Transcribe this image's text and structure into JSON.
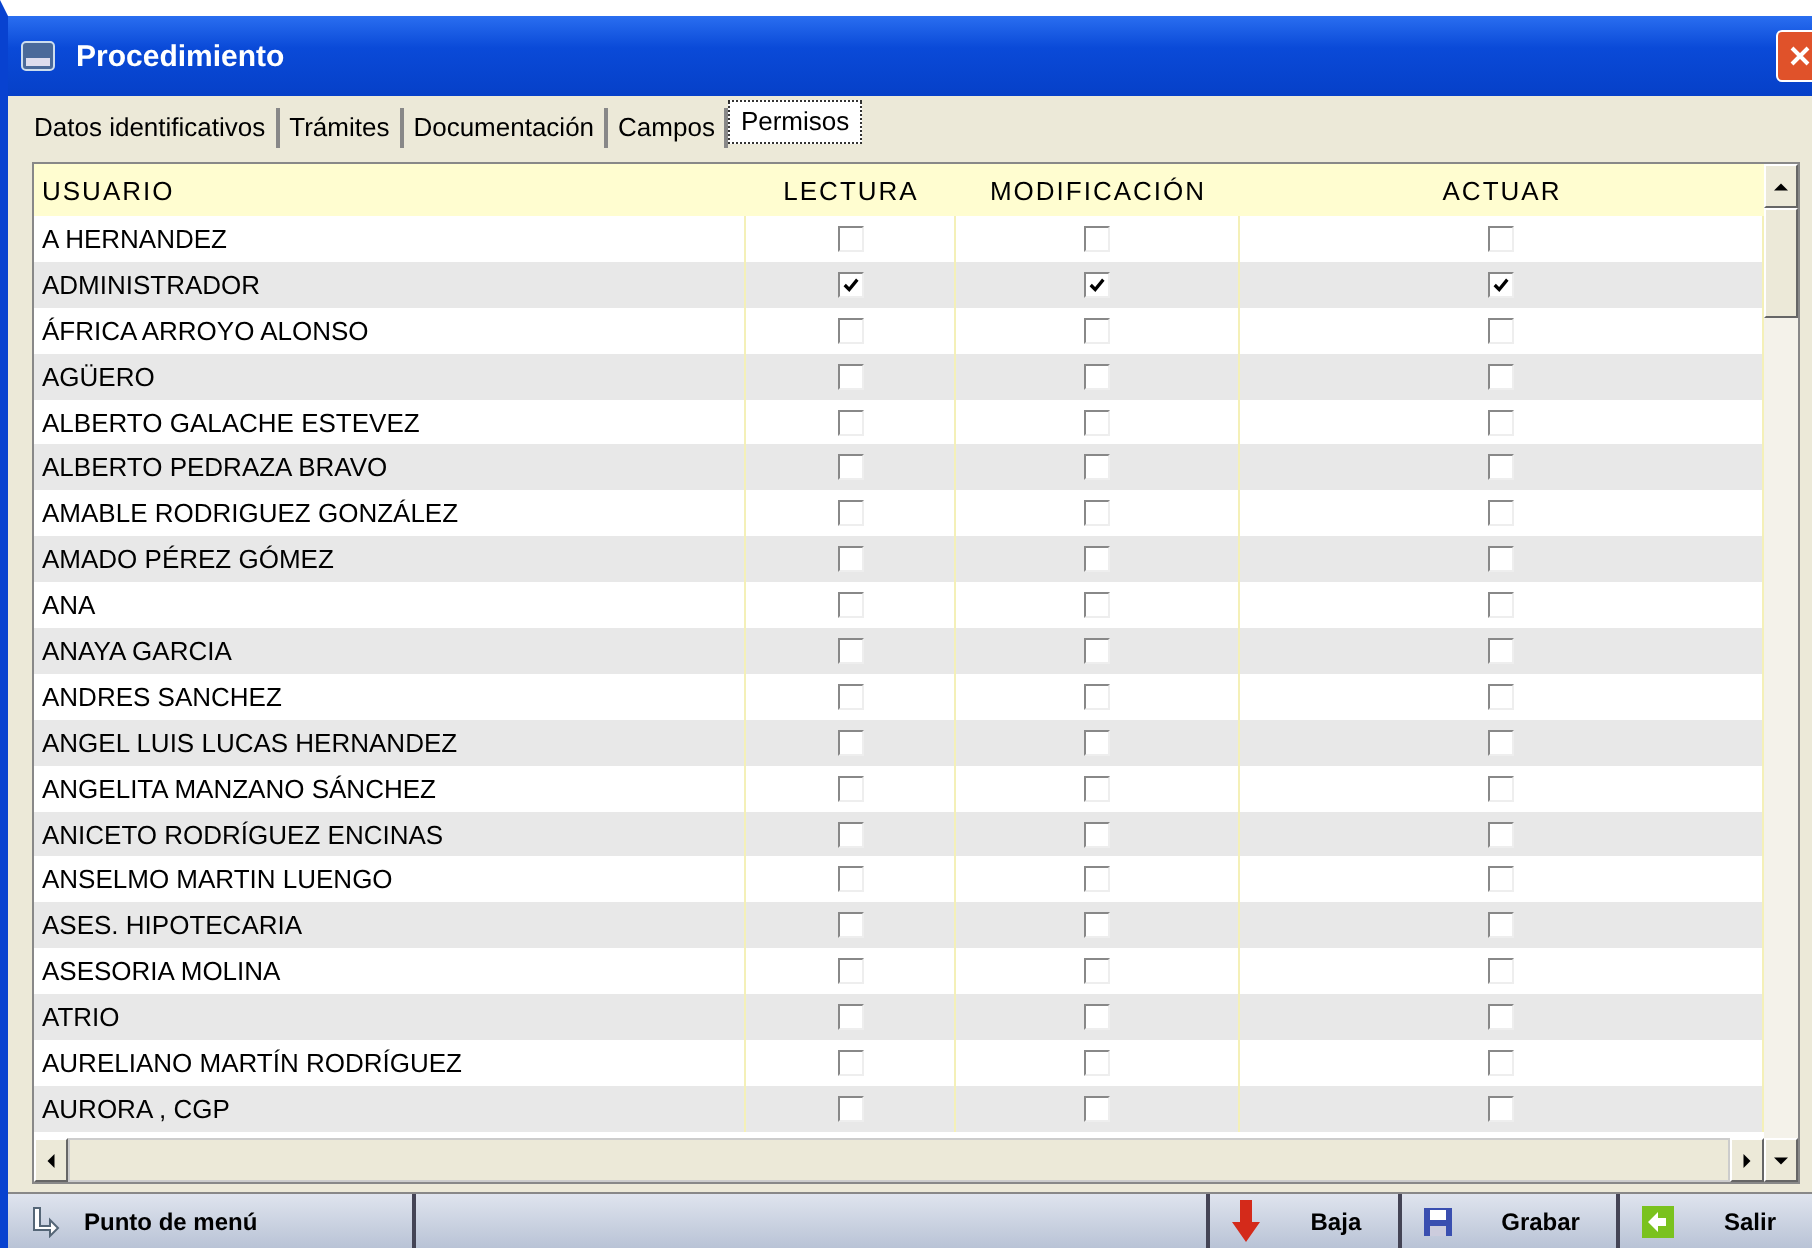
{
  "window": {
    "title": "Procedimiento"
  },
  "tabs": [
    {
      "label": "Datos identificativos",
      "selected": false
    },
    {
      "label": "Trámites",
      "selected": false
    },
    {
      "label": "Documentación",
      "selected": false
    },
    {
      "label": "Campos",
      "selected": false
    },
    {
      "label": "Permisos",
      "selected": true
    }
  ],
  "table": {
    "columns": [
      "USUARIO",
      "LECTURA",
      "MODIFICACIÓN",
      "ACTUAR"
    ],
    "rows": [
      {
        "usuario": "A HERNANDEZ",
        "lectura": false,
        "modificacion": false,
        "actuar": false
      },
      {
        "usuario": "ADMINISTRADOR",
        "lectura": true,
        "modificacion": true,
        "actuar": true
      },
      {
        "usuario": "ÁFRICA ARROYO ALONSO",
        "lectura": false,
        "modificacion": false,
        "actuar": false
      },
      {
        "usuario": "AGÜERO",
        "lectura": false,
        "modificacion": false,
        "actuar": false
      },
      {
        "usuario": "ALBERTO GALACHE ESTEVEZ",
        "lectura": false,
        "modificacion": false,
        "actuar": false
      },
      {
        "usuario": "ALBERTO PEDRAZA BRAVO",
        "lectura": false,
        "modificacion": false,
        "actuar": false
      },
      {
        "usuario": "AMABLE RODRIGUEZ GONZÁLEZ",
        "lectura": false,
        "modificacion": false,
        "actuar": false
      },
      {
        "usuario": "AMADO PÉREZ GÓMEZ",
        "lectura": false,
        "modificacion": false,
        "actuar": false
      },
      {
        "usuario": "ANA",
        "lectura": false,
        "modificacion": false,
        "actuar": false
      },
      {
        "usuario": "ANAYA GARCIA",
        "lectura": false,
        "modificacion": false,
        "actuar": false
      },
      {
        "usuario": "ANDRES SANCHEZ",
        "lectura": false,
        "modificacion": false,
        "actuar": false
      },
      {
        "usuario": "ANGEL LUIS LUCAS HERNANDEZ",
        "lectura": false,
        "modificacion": false,
        "actuar": false
      },
      {
        "usuario": "ANGELITA MANZANO SÁNCHEZ",
        "lectura": false,
        "modificacion": false,
        "actuar": false
      },
      {
        "usuario": "ANICETO RODRÍGUEZ ENCINAS",
        "lectura": false,
        "modificacion": false,
        "actuar": false
      },
      {
        "usuario": "ANSELMO MARTIN LUENGO",
        "lectura": false,
        "modificacion": false,
        "actuar": false
      },
      {
        "usuario": "ASES. HIPOTECARIA",
        "lectura": false,
        "modificacion": false,
        "actuar": false
      },
      {
        "usuario": "ASESORIA MOLINA",
        "lectura": false,
        "modificacion": false,
        "actuar": false
      },
      {
        "usuario": "ATRIO",
        "lectura": false,
        "modificacion": false,
        "actuar": false
      },
      {
        "usuario": "AURELIANO MARTÍN RODRÍGUEZ",
        "lectura": false,
        "modificacion": false,
        "actuar": false
      },
      {
        "usuario": "AURORA , CGP",
        "lectura": false,
        "modificacion": false,
        "actuar": false
      }
    ]
  },
  "toolbar": {
    "left": "Punto de menú",
    "buttons": [
      {
        "label": "Baja",
        "kind": "delete"
      },
      {
        "label": "Grabar",
        "kind": "save"
      },
      {
        "label": "Salir",
        "kind": "exit"
      }
    ]
  }
}
